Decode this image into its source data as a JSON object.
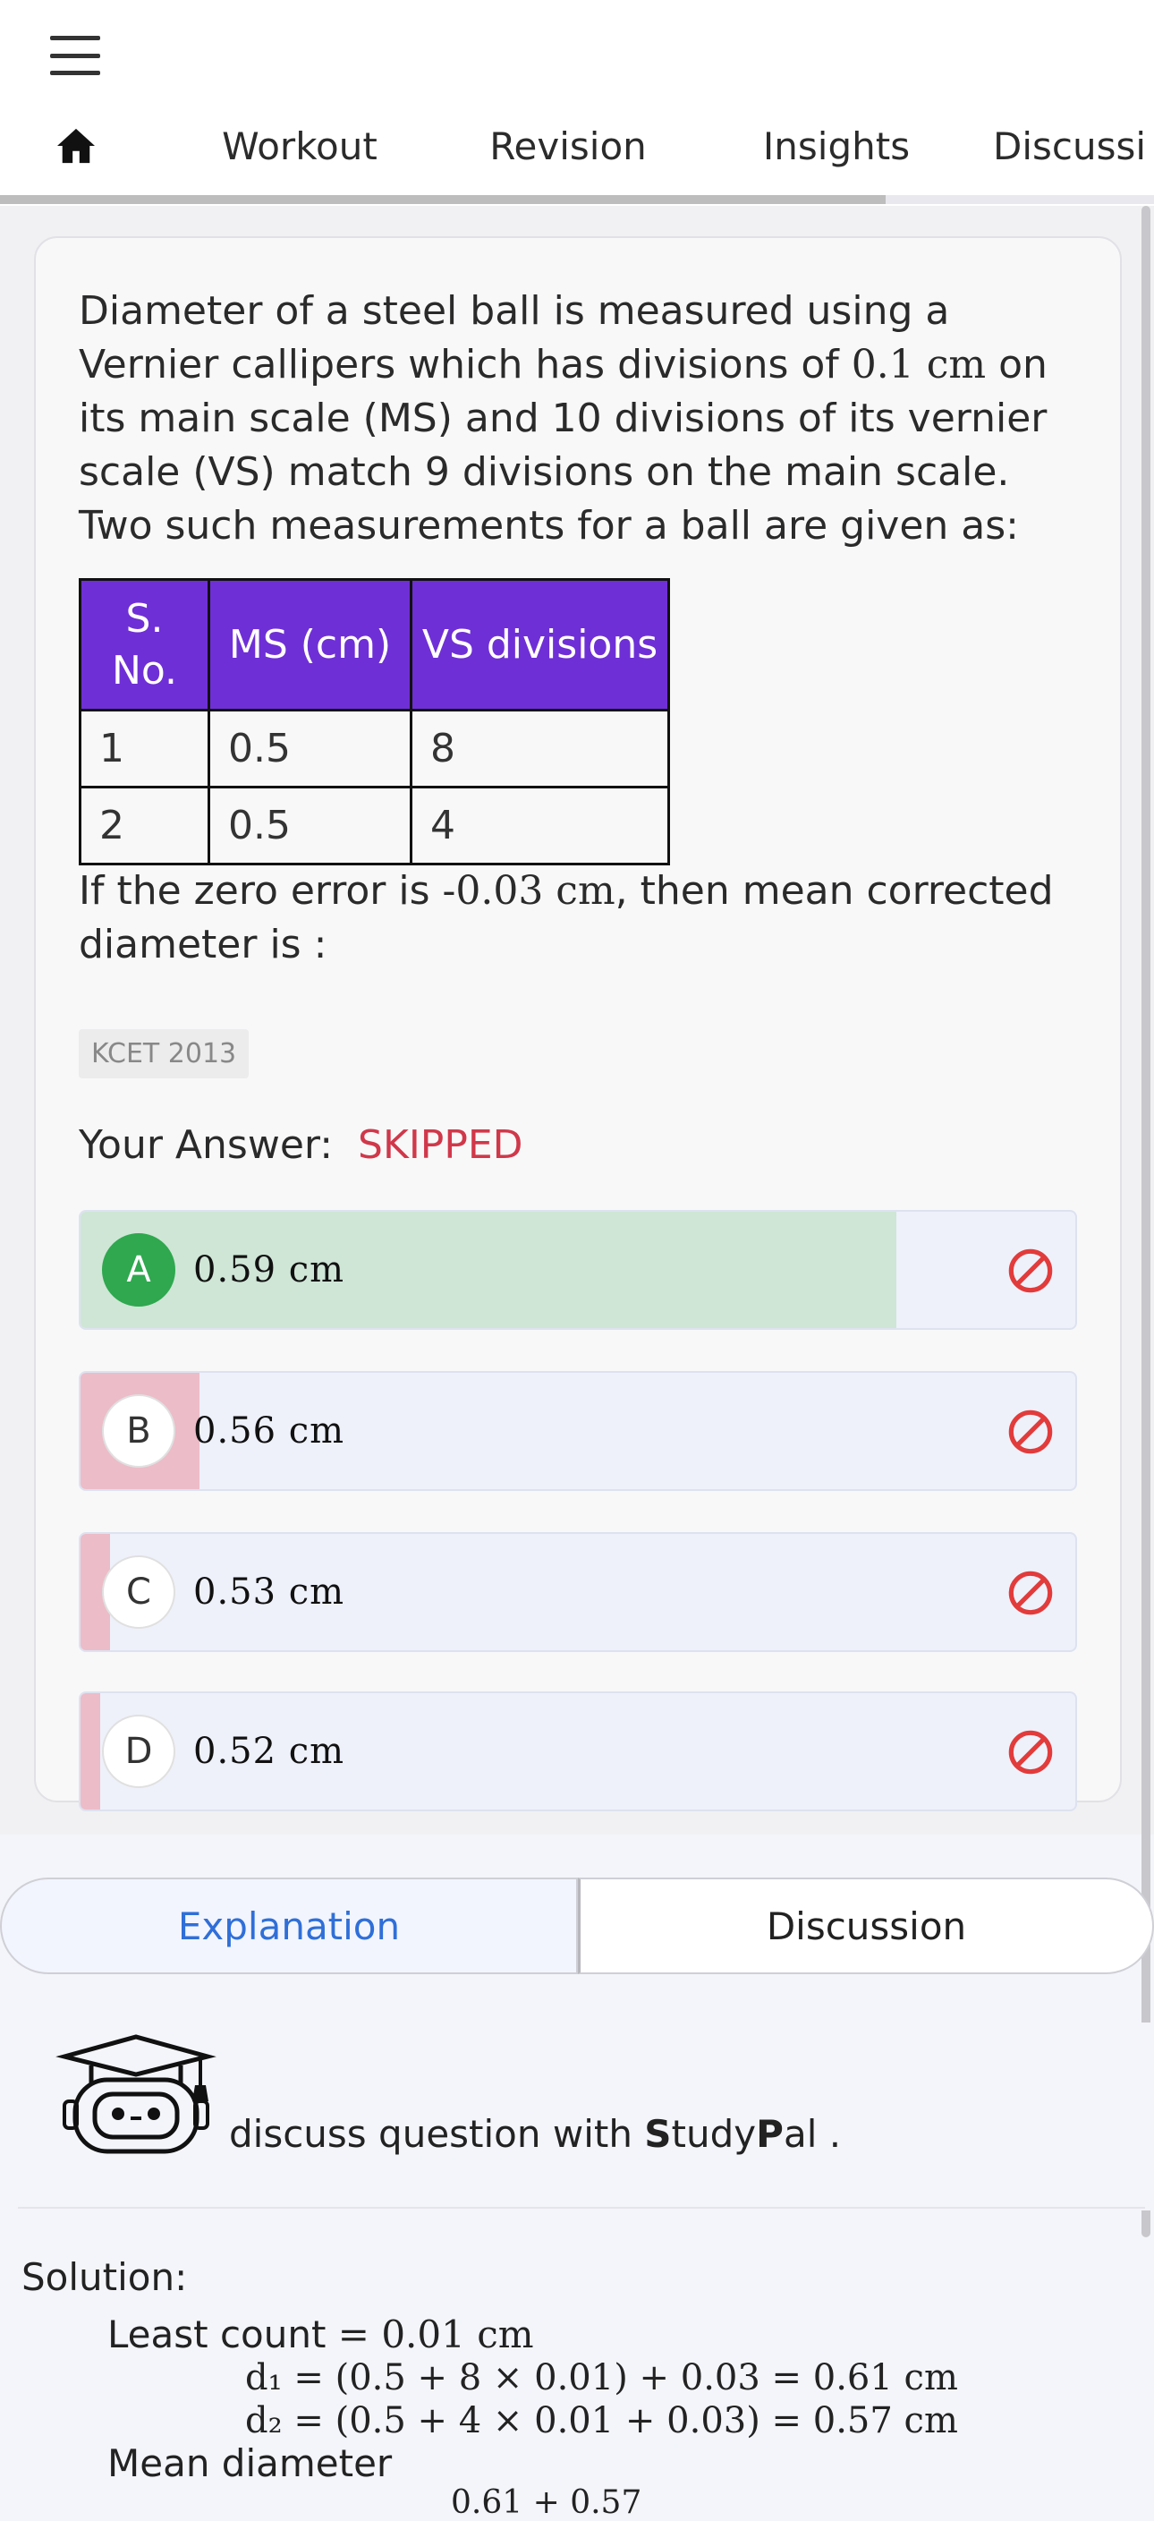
{
  "header": {
    "tabs": [
      {
        "icon": "home-icon"
      },
      {
        "label": "Workout"
      },
      {
        "label": "Revision"
      },
      {
        "label": "Insights"
      },
      {
        "label": "Discussi"
      }
    ]
  },
  "question": {
    "text_part1": "Diameter of a steel ball is measured using a Vernier callipers which has divisions of ",
    "math1": "0.1 cm",
    "text_part2": " on its main scale (MS) and 10 divisions of its vernier scale (VS) match 9 divisions on the main scale. Two such measurements for a ball are given as:",
    "table": {
      "headers": [
        "S. No.",
        "MS (cm)",
        "VS divisions"
      ],
      "rows": [
        [
          "1",
          "0.5",
          "8"
        ],
        [
          "2",
          "0.5",
          "4"
        ]
      ]
    },
    "after_part1": "If the zero error is ",
    "after_math": "-0.03 cm",
    "after_part2": ", then mean corrected diameter is :",
    "tag": "KCET 2013",
    "your_answer_label": "Your Answer:",
    "your_answer_status": "SKIPPED",
    "status_color": "#d0384a"
  },
  "options": [
    {
      "letter": "A",
      "text": "0.59 cm",
      "correct": true,
      "fill_fraction": 0.82,
      "fill_color": "#cfe6d6"
    },
    {
      "letter": "B",
      "text": "0.56 cm",
      "correct": false,
      "fill_fraction": 0.12,
      "fill_color": "#ecbcc8"
    },
    {
      "letter": "C",
      "text": "0.53 cm",
      "correct": false,
      "fill_fraction": 0.03,
      "fill_color": "#ecbcc8"
    },
    {
      "letter": "D",
      "text": "0.52 cm",
      "correct": false,
      "fill_fraction": 0.02,
      "fill_color": "#ecbcc8"
    }
  ],
  "segment": {
    "explanation": "Explanation",
    "discussion": "Discussion"
  },
  "studypal": {
    "text_prefix": "discuss question with ",
    "bold1": "S",
    "mid": "tudy",
    "bold2": "P",
    "suffix": "al ."
  },
  "solution": {
    "title": "Solution:",
    "least_count_label": "Least count ",
    "least_count_value": "= 0.01 cm",
    "d1": "d₁ = (0.5 + 8 × 0.01) + 0.03 = 0.61 cm",
    "d2": "d₂ = (0.5 + 4 × 0.01 + 0.03) = 0.57 cm",
    "mean_label": "Mean diameter",
    "partial": "0.61 + 0.57"
  },
  "colors": {
    "accent": "#6f2fd6",
    "link": "#2f6fd8",
    "correct": "#2fa84f",
    "wrong": "#d0384a"
  }
}
